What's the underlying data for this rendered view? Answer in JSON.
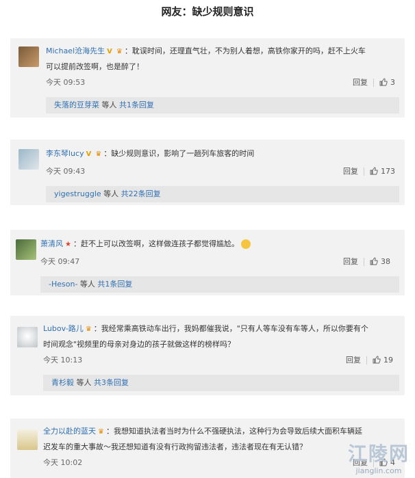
{
  "page": {
    "title": "网友：缺少规则意识"
  },
  "comments": [
    {
      "user": "Michael沧海先生",
      "badges": [
        "V",
        "🏆"
      ],
      "text_line1": "：耽误时间，还理直气壮，不为别人着想，高铁你家开的吗，赶不上火车",
      "text_line2": "可以提前改签啊，也是醉了！",
      "time": "今天 09:53",
      "reply_label": "回复",
      "likes": "3",
      "reply_user": "失落的豆芽菜",
      "reply_mid": " 等人 ",
      "reply_count": "共1条回复"
    },
    {
      "user": "李东琴lucy",
      "badges": [
        "V",
        "🏆"
      ],
      "text_line1": "：缺少规则意识，影响了一趟列车旅客的时间",
      "text_line2": "",
      "time": "今天 09:43",
      "reply_label": "回复",
      "likes": "173",
      "reply_user": "yigestruggle",
      "reply_mid": " 等人 ",
      "reply_count": "共22条回复"
    },
    {
      "user": "萧清风",
      "badges": [
        "★"
      ],
      "text_line1": "：赶不上可以改签啊，这样做连孩子都觉得尴尬。",
      "text_line2": "",
      "time": "今天 09:47",
      "reply_label": "回复",
      "likes": "38",
      "reply_user": "-Heson-",
      "reply_mid": " 等人 ",
      "reply_count": "共1条回复"
    },
    {
      "user": "Lubov-路儿",
      "badges": [
        "🏆"
      ],
      "text_line1": "：我经常乘高铁动车出行，我妈都催我说，\"只有人等车没有车等人，所以你要有个",
      "text_line2": "时间观念\"视频里的母亲对身边的孩子就做这样的榜样吗？",
      "time": "今天 10:13",
      "reply_label": "回复",
      "likes": "19",
      "reply_user": "青杉毅",
      "reply_mid": " 等人 ",
      "reply_count": "共3条回复"
    },
    {
      "user": "全力以赴的蓝天",
      "badges": [
        "🏆"
      ],
      "text_line1": "：我想知道执法者当时为什么不强硬执法，这种行为会导致后续大面积车辆延",
      "text_line2": "迟发车的重大事故～我还想知道有没有行政拘留违法者，违法者现在有无认错？",
      "time": "今天 10:02",
      "reply_label": "回复",
      "likes": "4",
      "reply_user": "",
      "reply_mid": "",
      "reply_count": ""
    }
  ],
  "watermark": {
    "logo": "江陵网",
    "url": "jianglin.com"
  },
  "colors": {
    "link": "#2f6fb3",
    "card_bg": "#f2f2f2",
    "reply_bg": "#e6e6e6"
  }
}
